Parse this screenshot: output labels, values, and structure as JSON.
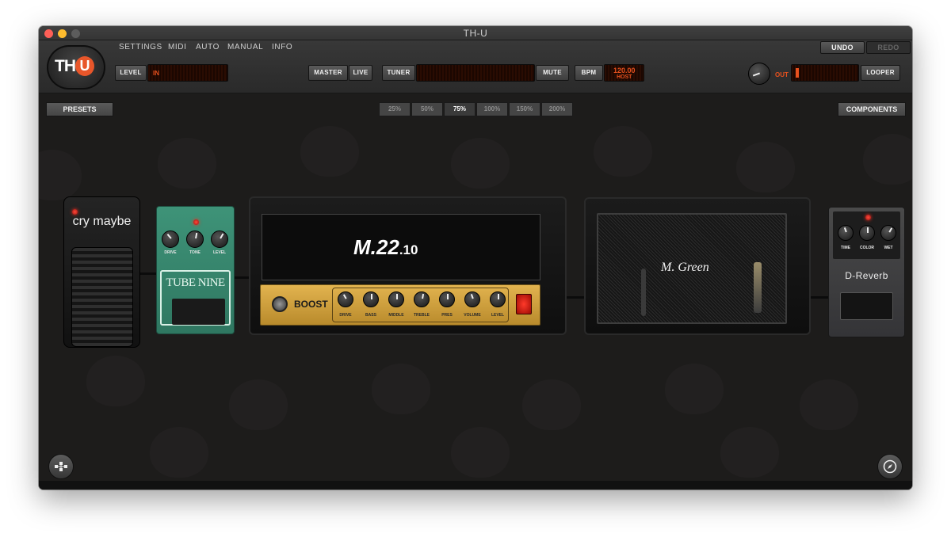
{
  "window": {
    "title": "TH-U"
  },
  "menu": [
    "SETTINGS",
    "MIDI",
    "AUTO",
    "MANUAL",
    "INFO"
  ],
  "history": {
    "undo": "UNDO",
    "redo": "REDO"
  },
  "logo": {
    "text_th": "TH",
    "text_u": "U"
  },
  "toolbar": {
    "level": "LEVEL",
    "level_in": "IN",
    "master": "MASTER",
    "live": "LIVE",
    "tuner": "TUNER",
    "mute": "MUTE",
    "bpm": "BPM",
    "bpm_value": "120.00",
    "bpm_source": "HOST",
    "out": "OUT",
    "looper": "LOOPER"
  },
  "side": {
    "presets": "PRESETS",
    "components": "COMPONENTS"
  },
  "zoom": [
    {
      "label": "25%",
      "active": false
    },
    {
      "label": "50%",
      "active": false
    },
    {
      "label": "75%",
      "active": true
    },
    {
      "label": "100%",
      "active": false
    },
    {
      "label": "150%",
      "active": false
    },
    {
      "label": "200%",
      "active": false
    }
  ],
  "wah": {
    "name": "cry maybe"
  },
  "tube": {
    "name": "TUBE NINE",
    "knobs": [
      "DRIVE",
      "TONE",
      "LEVEL"
    ]
  },
  "amp": {
    "name_prefix": "M.",
    "name_main": "22",
    "name_suffix": ".10",
    "boost": "BOOST",
    "knobs": [
      "DRIVE",
      "BASS",
      "MIDDLE",
      "TREBLE",
      "PRES",
      "VOLUME",
      "LEVEL"
    ]
  },
  "cab": {
    "name": "M. Green"
  },
  "reverb": {
    "name": "D-Reverb",
    "knobs": [
      "TIME",
      "COLOR",
      "WET"
    ]
  },
  "colors": {
    "accent": "#e8562a",
    "display_text": "#e8511e",
    "tube_green": "#3e9378",
    "amp_gold": "#d4a440"
  },
  "icons": {
    "left_corner": "routing-icon",
    "right_corner": "compass-icon"
  }
}
